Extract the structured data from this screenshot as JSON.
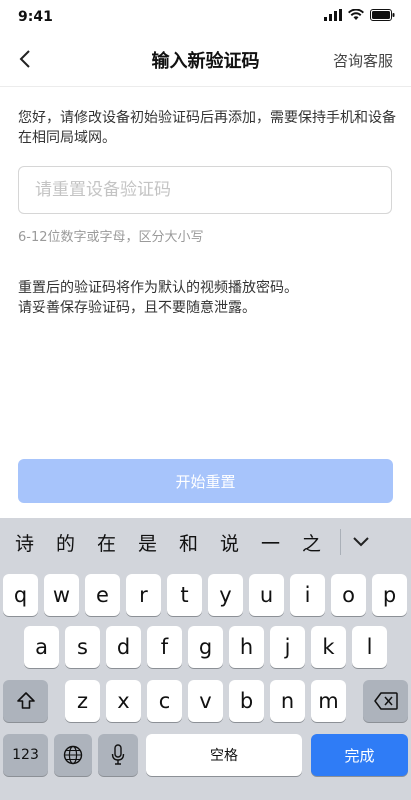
{
  "status": {
    "time": "9:41"
  },
  "nav": {
    "title": "输入新验证码",
    "right_link": "咨询客服"
  },
  "content": {
    "description": "您好，请修改设备初始验证码后再添加，需要保持手机和设备在相同局域网。",
    "input_placeholder": "请重置设备验证码",
    "hint": "6-12位数字或字母，区分大小写",
    "note_line1": "重置后的验证码将作为默认的视频播放密码。",
    "note_line2": "请妥善保存验证码，且不要随意泄露。"
  },
  "button": {
    "start_label": "开始重置"
  },
  "keyboard": {
    "candidates": [
      "诗",
      "的",
      "在",
      "是",
      "和",
      "说",
      "一",
      "之"
    ],
    "row1": [
      "q",
      "w",
      "e",
      "r",
      "t",
      "y",
      "u",
      "i",
      "o",
      "p"
    ],
    "row2": [
      "a",
      "s",
      "d",
      "f",
      "g",
      "h",
      "j",
      "k",
      "l"
    ],
    "row3": [
      "z",
      "x",
      "c",
      "v",
      "b",
      "n",
      "m"
    ],
    "numbers_label": "123",
    "space_label": "空格",
    "done_label": "完成",
    "accent_color": "#2f7cf6"
  }
}
